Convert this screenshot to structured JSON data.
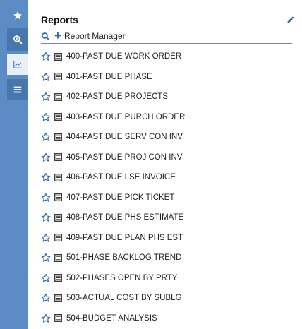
{
  "panel": {
    "title": "Reports",
    "toolbar_label": "Report Manager"
  },
  "sidebar": {
    "items": [
      {
        "icon": "star-icon"
      },
      {
        "icon": "zoom-in-icon"
      },
      {
        "icon": "chart-line-icon"
      },
      {
        "icon": "menu-icon"
      }
    ]
  },
  "reports": [
    {
      "name": "400-PAST DUE WORK ORDER"
    },
    {
      "name": "401-PAST DUE PHASE"
    },
    {
      "name": "402-PAST DUE PROJECTS"
    },
    {
      "name": "403-PAST DUE PURCH ORDER"
    },
    {
      "name": "404-PAST DUE SERV CON INV"
    },
    {
      "name": "405-PAST DUE PROJ CON INV"
    },
    {
      "name": "406-PAST DUE LSE INVOICE"
    },
    {
      "name": "407-PAST DUE PICK TICKET"
    },
    {
      "name": "408-PAST DUE PHS ESTIMATE"
    },
    {
      "name": "409-PAST DUE PLAN PHS EST"
    },
    {
      "name": "501-PHASE BACKLOG TREND"
    },
    {
      "name": "502-PHASES OPEN BY PRTY"
    },
    {
      "name": "503-ACTUAL COST BY SUBLG"
    },
    {
      "name": "504-BUDGET ANALYSIS"
    }
  ],
  "colors": {
    "rail": "#5b8cc6",
    "accent": "#2a67b8"
  }
}
